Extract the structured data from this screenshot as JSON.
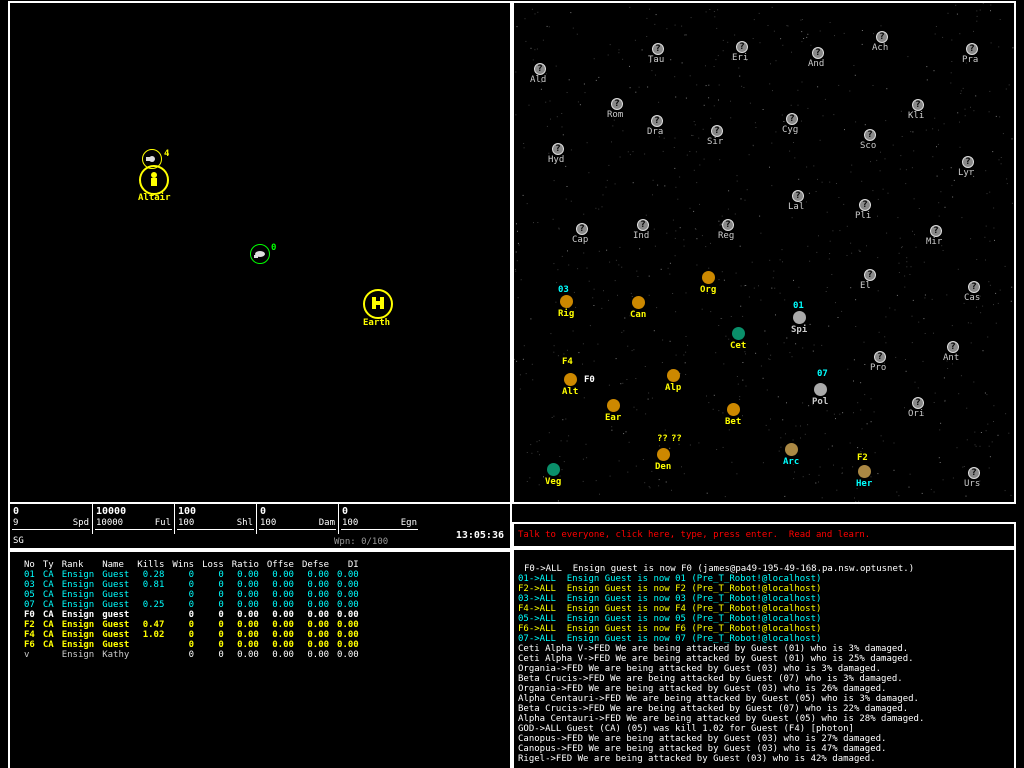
{
  "colors": {
    "fed": "#ffff00",
    "rom": "#ff3030",
    "ori": "#00ffff",
    "ind": "#cccccc",
    "text": "#ffffff",
    "highlight": "#ff0000"
  },
  "tactical": {
    "planets": [
      {
        "name": "Altair",
        "icon": "planet-icon"
      },
      {
        "name": "Earth",
        "icon": "planet-icon"
      }
    ],
    "ships": [
      {
        "id": "4",
        "icon": "federation-ship-icon"
      },
      {
        "id": "0",
        "icon": "self-ship-icon"
      }
    ]
  },
  "galactic": {
    "unknown_planets": [
      "Ald",
      "Tau",
      "Eri",
      "And",
      "Ach",
      "Pra",
      "Rom",
      "Dra",
      "Sir",
      "Cyg",
      "Kli",
      "Hyd",
      "Sco",
      "Lyr",
      "Lal",
      "Pli",
      "Cap",
      "Ind",
      "Reg",
      "Mir",
      "El",
      "Cas",
      "Pro",
      "Ant",
      "Ori",
      "Urs"
    ],
    "known_planets": [
      {
        "name": "Org",
        "owner": "fed"
      },
      {
        "name": "Rig",
        "owner": "fed"
      },
      {
        "name": "Can",
        "owner": "fed"
      },
      {
        "name": "Cet",
        "owner": "fed"
      },
      {
        "name": "Spi",
        "owner": "ind"
      },
      {
        "name": "Alp",
        "owner": "fed"
      },
      {
        "name": "Alt",
        "owner": "fed"
      },
      {
        "name": "Ear",
        "owner": "fed"
      },
      {
        "name": "Bet",
        "owner": "fed"
      },
      {
        "name": "Pol",
        "owner": "ind"
      },
      {
        "name": "Den",
        "owner": "fed"
      },
      {
        "name": "Arc",
        "owner": "ori"
      },
      {
        "name": "Veg",
        "owner": "fed"
      },
      {
        "name": "Her",
        "owner": "ori"
      }
    ],
    "ship_markers": [
      "03",
      "01",
      "F4",
      "F0",
      "07",
      "??",
      "??",
      "F2"
    ]
  },
  "gauges": [
    {
      "value": "0",
      "sub": "9",
      "label": "Spd"
    },
    {
      "value": "10000",
      "sub": "10000",
      "label": "Ful"
    },
    {
      "value": "100",
      "sub": "100",
      "label": "Shl"
    },
    {
      "value": "0",
      "sub": "100",
      "label": "Dam"
    },
    {
      "value": "0",
      "sub": "100",
      "label": "Egn"
    }
  ],
  "status": {
    "flags": "SG",
    "weapon_temp": "Wpn: 0/100",
    "clock": "13:05:36"
  },
  "warning": {
    "text": "Talk to everyone, click here, type, press enter.  Read and learn."
  },
  "players": {
    "headers": [
      "No",
      "Ty",
      "Rank",
      "Name",
      "Kills",
      "Wins",
      "Loss",
      "Ratio",
      "Offse",
      "Defse",
      "DI"
    ],
    "rows": [
      {
        "no": "01",
        "ty": "CA",
        "rank": "Ensign",
        "name": "Guest",
        "kills": "0.28",
        "wins": "0",
        "loss": "0",
        "ratio": "0.00",
        "offse": "0.00",
        "defse": "0.00",
        "di": "0.00",
        "team": "ori",
        "bold": false
      },
      {
        "no": "03",
        "ty": "CA",
        "rank": "Ensign",
        "name": "Guest",
        "kills": "0.81",
        "wins": "0",
        "loss": "0",
        "ratio": "0.00",
        "offse": "0.00",
        "defse": "0.00",
        "di": "0.00",
        "team": "ori",
        "bold": false
      },
      {
        "no": "05",
        "ty": "CA",
        "rank": "Ensign",
        "name": "Guest",
        "kills": "",
        "wins": "0",
        "loss": "0",
        "ratio": "0.00",
        "offse": "0.00",
        "defse": "0.00",
        "di": "0.00",
        "team": "ori",
        "bold": false
      },
      {
        "no": "07",
        "ty": "CA",
        "rank": "Ensign",
        "name": "Guest",
        "kills": "0.25",
        "wins": "0",
        "loss": "0",
        "ratio": "0.00",
        "offse": "0.00",
        "defse": "0.00",
        "di": "0.00",
        "team": "ori",
        "bold": false
      },
      {
        "no": "F0",
        "ty": "CA",
        "rank": "Ensign",
        "name": "guest",
        "kills": "",
        "wins": "0",
        "loss": "0",
        "ratio": "0.00",
        "offse": "0.00",
        "defse": "0.00",
        "di": "0.00",
        "team": "self",
        "bold": true
      },
      {
        "no": "F2",
        "ty": "CA",
        "rank": "Ensign",
        "name": "Guest",
        "kills": "0.47",
        "wins": "0",
        "loss": "0",
        "ratio": "0.00",
        "offse": "0.00",
        "defse": "0.00",
        "di": "0.00",
        "team": "fed",
        "bold": true
      },
      {
        "no": "F4",
        "ty": "CA",
        "rank": "Ensign",
        "name": "Guest",
        "kills": "1.02",
        "wins": "0",
        "loss": "0",
        "ratio": "0.00",
        "offse": "0.00",
        "defse": "0.00",
        "di": "0.00",
        "team": "fed",
        "bold": true
      },
      {
        "no": "F6",
        "ty": "CA",
        "rank": "Ensign",
        "name": "Guest",
        "kills": "",
        "wins": "0",
        "loss": "0",
        "ratio": "0.00",
        "offse": "0.00",
        "defse": "0.00",
        "di": "0.00",
        "team": "fed",
        "bold": true
      },
      {
        "no": "v",
        "ty": "",
        "rank": "Ensign",
        "name": "Kathy",
        "kills": "",
        "wins": "0",
        "loss": "0",
        "ratio": "0.00",
        "offse": "0.00",
        "defse": "0.00",
        "di": "0.00",
        "team": "ind",
        "bold": false
      }
    ]
  },
  "messages": [
    {
      "text": "F0->ALL  Ensign guest is now F0 (james@pa49-195-49-168.pa.nsw.optusnet.)",
      "team": "text"
    },
    {
      "text": "01->ALL  Ensign Guest is now 01 (Pre_T_Robot!@localhost)",
      "team": "ori"
    },
    {
      "text": "F2->ALL  Ensign Guest is now F2 (Pre_T_Robot!@localhost)",
      "team": "fed"
    },
    {
      "text": "03->ALL  Ensign Guest is now 03 (Pre_T_Robot!@localhost)",
      "team": "ori"
    },
    {
      "text": "F4->ALL  Ensign Guest is now F4 (Pre_T_Robot!@localhost)",
      "team": "fed"
    },
    {
      "text": "05->ALL  Ensign Guest is now 05 (Pre_T_Robot!@localhost)",
      "team": "ori"
    },
    {
      "text": "F6->ALL  Ensign Guest is now F6 (Pre_T_Robot!@localhost)",
      "team": "fed"
    },
    {
      "text": "07->ALL  Ensign Guest is now 07 (Pre_T_Robot!@localhost)",
      "team": "ori"
    },
    {
      "text": "Ceti Alpha V->FED We are being attacked by Guest (01) who is 3% damaged.",
      "team": "text"
    },
    {
      "text": "Ceti Alpha V->FED We are being attacked by Guest (01) who is 25% damaged.",
      "team": "text"
    },
    {
      "text": "Organia->FED We are being attacked by Guest (03) who is 3% damaged.",
      "team": "text"
    },
    {
      "text": "Beta Crucis->FED We are being attacked by Guest (07) who is 3% damaged.",
      "team": "text"
    },
    {
      "text": "Organia->FED We are being attacked by Guest (03) who is 26% damaged.",
      "team": "text"
    },
    {
      "text": "Alpha Centauri->FED We are being attacked by Guest (05) who is 3% damaged.",
      "team": "text"
    },
    {
      "text": "Beta Crucis->FED We are being attacked by Guest (07) who is 22% damaged.",
      "team": "text"
    },
    {
      "text": "Alpha Centauri->FED We are being attacked by Guest (05) who is 28% damaged.",
      "team": "text"
    },
    {
      "text": "GOD->ALL Guest (CA) (05) was kill 1.02 for Guest (F4) [photon]",
      "team": "text"
    },
    {
      "text": "Canopus->FED We are being attacked by Guest (03) who is 27% damaged.",
      "team": "text"
    },
    {
      "text": "Canopus->FED We are being attacked by Guest (03) who is 47% damaged.",
      "team": "text"
    },
    {
      "text": "Rigel->FED We are being attacked by Guest (03) who is 42% damaged.",
      "team": "text"
    }
  ]
}
